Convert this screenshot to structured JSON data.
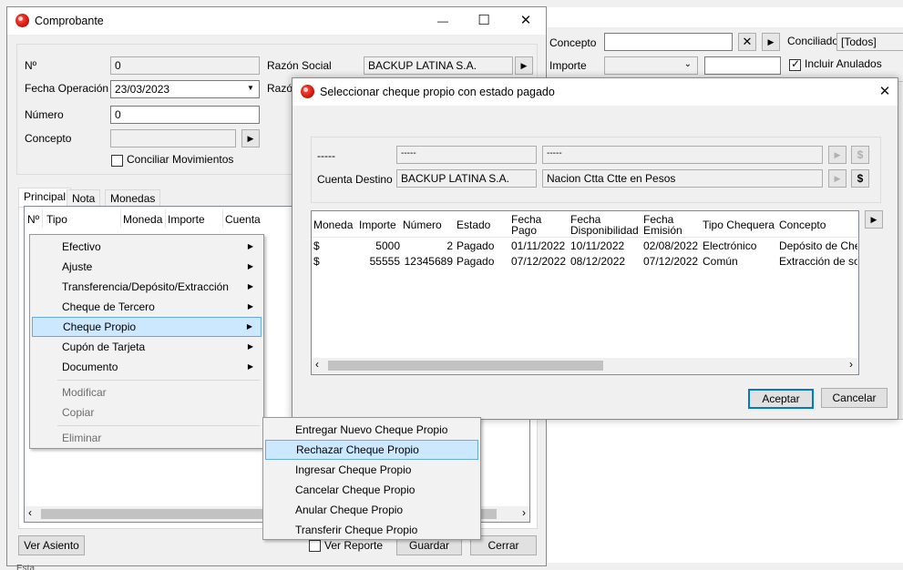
{
  "bg_window": {
    "concepto_label": "Concepto",
    "conciliado_label": "Conciliado",
    "conciliado_value": "[Todos]",
    "importe_label": "Importe",
    "incluir_anulados_label": "Incluir Anulados",
    "close_glyph": "✕",
    "arrow_glyph": "▶"
  },
  "comprobante": {
    "title": "Comprobante",
    "minimize": "—",
    "maximize": "☐",
    "close": "✕",
    "fields": {
      "n_label": "Nº",
      "n_value": "0",
      "fecha_label": "Fecha Operación",
      "fecha_value": "23/03/2023",
      "numero_label": "Número",
      "numero_value": "0",
      "concepto_label": "Concepto",
      "concepto_value": "",
      "conciliar_label": "Conciliar Movimientos",
      "razon_label": "Razón Social",
      "razon_value": "BACKUP LATINA S.A.",
      "razon2_label": "Razó"
    },
    "tabs": [
      "Principal",
      "Nota",
      "Monedas"
    ],
    "grid_headers": [
      "Nº",
      "Tipo",
      "Moneda",
      "Importe",
      "Cuenta"
    ],
    "buttons": {
      "ver_asiento": "Ver Asiento",
      "ver_reporte": "Ver Reporte",
      "guardar": "Guardar",
      "cerrar": "Cerrar"
    }
  },
  "context_menu": {
    "items": [
      {
        "label": "Efectivo",
        "submenu": true
      },
      {
        "label": "Ajuste",
        "submenu": true
      },
      {
        "label": "Transferencia/Depósito/Extracción",
        "submenu": true
      },
      {
        "label": "Cheque de Tercero",
        "submenu": true
      },
      {
        "label": "Cheque Propio",
        "submenu": true,
        "selected": true
      },
      {
        "label": "Cupón de Tarjeta",
        "submenu": true
      },
      {
        "label": "Documento",
        "submenu": true
      },
      {
        "label": "Modificar",
        "disabled": true
      },
      {
        "label": "Copiar",
        "disabled": true
      },
      {
        "label": "Eliminar",
        "disabled": true
      }
    ],
    "arrow_glyph": "▶"
  },
  "submenu": {
    "items": [
      "Entregar Nuevo Cheque Propio",
      "Rechazar Cheque Propio",
      "Ingresar Cheque Propio",
      "Cancelar Cheque Propio",
      "Anular Cheque Propio",
      "Transferir Cheque Propio"
    ],
    "selected_index": 1
  },
  "dialog": {
    "title": "Seleccionar cheque propio con estado pagado",
    "close": "✕",
    "row1_label": "-----",
    "row1_field1": "-----",
    "row1_field2": "-----",
    "cuenta_label": "Cuenta Destino",
    "cuenta_value1": "BACKUP LATINA S.A.",
    "cuenta_value2": "Nacion Ctta Ctte en Pesos",
    "dollar_glyph": "$",
    "arrow_glyph": "▶",
    "columns": [
      "Moneda",
      "Importe",
      "Número",
      "Estado",
      "Fecha\nPago",
      "Fecha\nDisponibilidad",
      "Fecha\nEmisión",
      "Tipo Chequera",
      "Concepto"
    ],
    "rows": [
      [
        "$",
        "5000",
        "2",
        "Pagado",
        "01/11/2022",
        "10/11/2022",
        "02/08/2022",
        "Electrónico",
        "Depósito de Cheq"
      ],
      [
        "$",
        "55555",
        "12345689",
        "Pagado",
        "07/12/2022",
        "08/12/2022",
        "07/12/2022",
        "Común",
        "Extracción de soc"
      ]
    ],
    "aceptar": "Aceptar",
    "cancelar": "Cancelar"
  },
  "bottom_strip": {
    "fragment": "Esta"
  }
}
